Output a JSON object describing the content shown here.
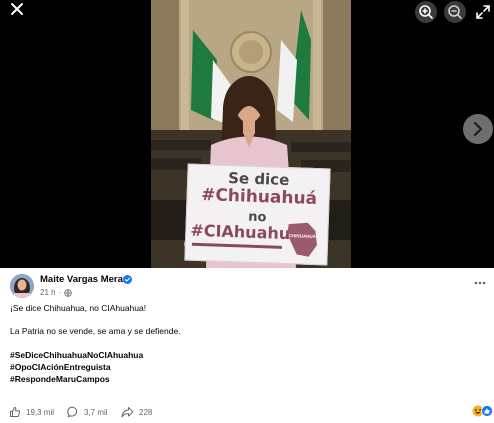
{
  "viewer": {
    "sign": {
      "line1": "Se dice",
      "line2": "#Chihuahuá",
      "line3": "no",
      "line4": "#CIAhuahua",
      "map_label": "CHIHUAHUA"
    }
  },
  "post": {
    "author": "Maite Vargas Meraz",
    "time": "21 h",
    "separator": "·",
    "lines": [
      "¡Se dice Chihuahua, no CIAhuahua!",
      "La Patria no se vende, se ama y se defiende."
    ],
    "hashtags": [
      "#SeDiceChihuahuaNoCIAhuahua",
      "#OpoCIAciónEntreguista",
      "#RespondeMaruCampos"
    ],
    "likes": "19,3 mil",
    "comments": "3,7 mil",
    "shares": "228"
  },
  "icons": {
    "close": "close-icon",
    "zoom_in": "zoom-in-icon",
    "zoom_out": "zoom-out-icon",
    "fullscreen": "fullscreen-icon",
    "next": "chevron-right-icon",
    "verified": "verified-badge-icon",
    "globe": "globe-icon",
    "more": "more-options-icon",
    "like": "thumbs-up-icon",
    "comment": "comment-icon",
    "share": "share-icon"
  },
  "colors": {
    "viewer_bg": "#000000",
    "sign_text": "#8a4a5c",
    "verified": "#1877f2",
    "meta_text": "#65676b"
  }
}
